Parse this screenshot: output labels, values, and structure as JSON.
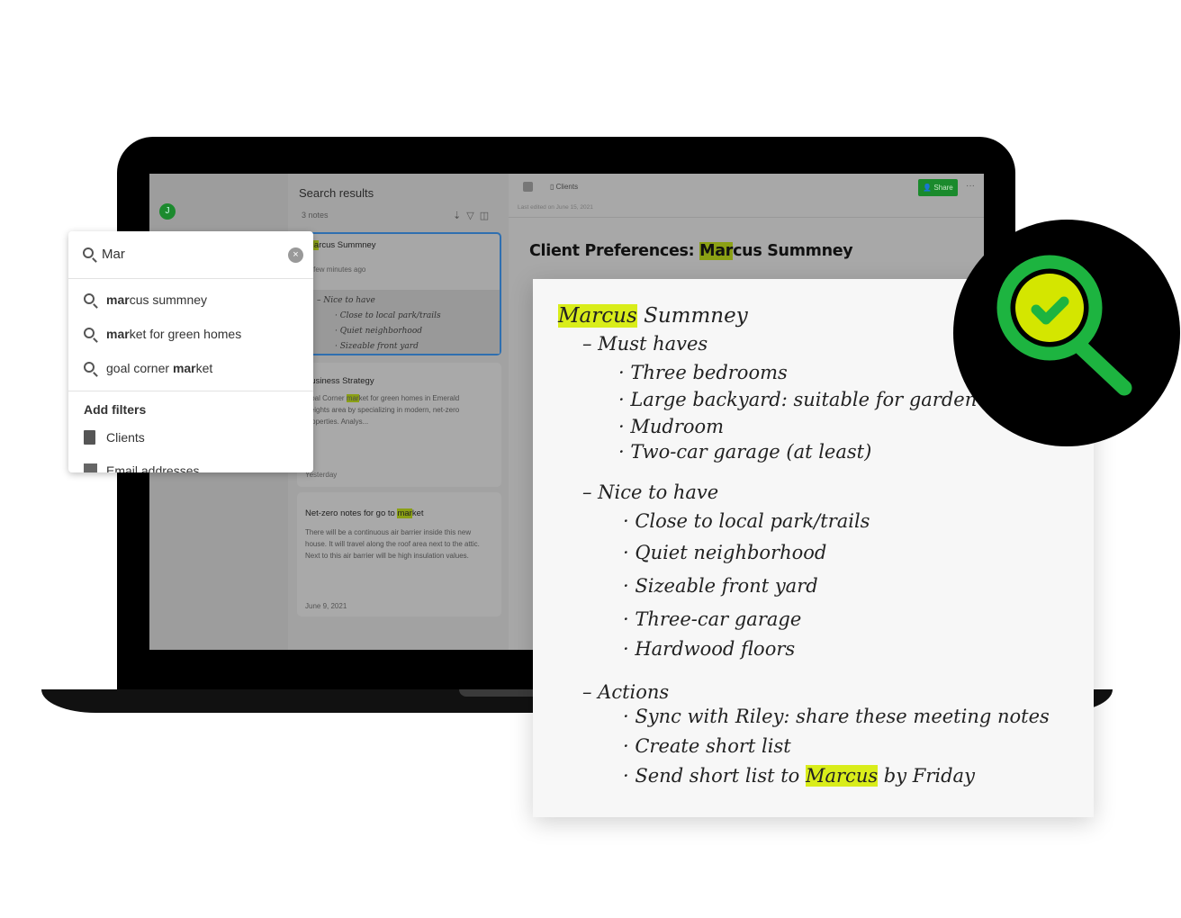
{
  "sidebar": {
    "avatar_initial": "J"
  },
  "list": {
    "title": "Search results",
    "count": "3 notes",
    "notes": [
      {
        "title_hl": "Ma",
        "title_rest": "rcus Summney",
        "time": "A few minutes ago",
        "snippet": [
          "– Nice to have",
          "· Close to local park/trails",
          "· Quiet neighborhood",
          "· Sizeable front yard"
        ]
      },
      {
        "title": "Business Strategy",
        "body_pre": "Goal Corner ",
        "body_hl": "mar",
        "body_post": "ket for green homes in Emerald Heights area by specializing in modern, net-zero properties. Analys...",
        "date": "Yesterday"
      },
      {
        "title_pre": "Net-zero notes for go to ",
        "title_hl": "mar",
        "title_post": "ket",
        "body": "There will be a continuous air barrier inside this new house. It will travel along the roof area next to the attic. Next to this air barrier will be high insulation values.",
        "date": "June 9, 2021"
      }
    ]
  },
  "editor": {
    "notebook": "Clients",
    "share_label": "Share",
    "more": "···",
    "last_edited": "Last edited on June 15, 2021",
    "title_pre": "Client Preferences: ",
    "title_hl": "Mar",
    "title_post": "cus Summney"
  },
  "search": {
    "value": "Mar",
    "clear": "×",
    "suggestions": [
      {
        "bold": "mar",
        "rest": "cus summney",
        "pre": ""
      },
      {
        "bold": "mar",
        "rest": "ket for green homes",
        "pre": ""
      },
      {
        "pre": "goal corner ",
        "bold": "mar",
        "rest": "ket"
      }
    ],
    "filters_heading": "Add filters",
    "filters": [
      "Clients",
      "Email addresses"
    ]
  },
  "handwritten": {
    "name_hl": "Marcus",
    "name_rest": " Summney",
    "must_heading": "– Must haves",
    "must": [
      "· Three bedrooms",
      "· Large backyard: suitable for garden",
      "· Mudroom",
      "· Two-car garage (at least)"
    ],
    "nice_heading": "– Nice to have",
    "nice": [
      "· Close to local park/trails",
      "· Quiet neighborhood",
      "· Sizeable front yard",
      "· Three-car garage",
      "· Hardwood floors"
    ],
    "actions_heading": "– Actions",
    "actions": [
      "· Sync with Riley: share these meeting notes",
      "· Create short list"
    ],
    "last_pre": "· Send short list to ",
    "last_hl": "Marcus",
    "last_post": " by Friday"
  },
  "colors": {
    "green": "#1db440",
    "lime": "#d4e600",
    "highlight": "#d9ed1a",
    "share": "#1a8a2c"
  }
}
